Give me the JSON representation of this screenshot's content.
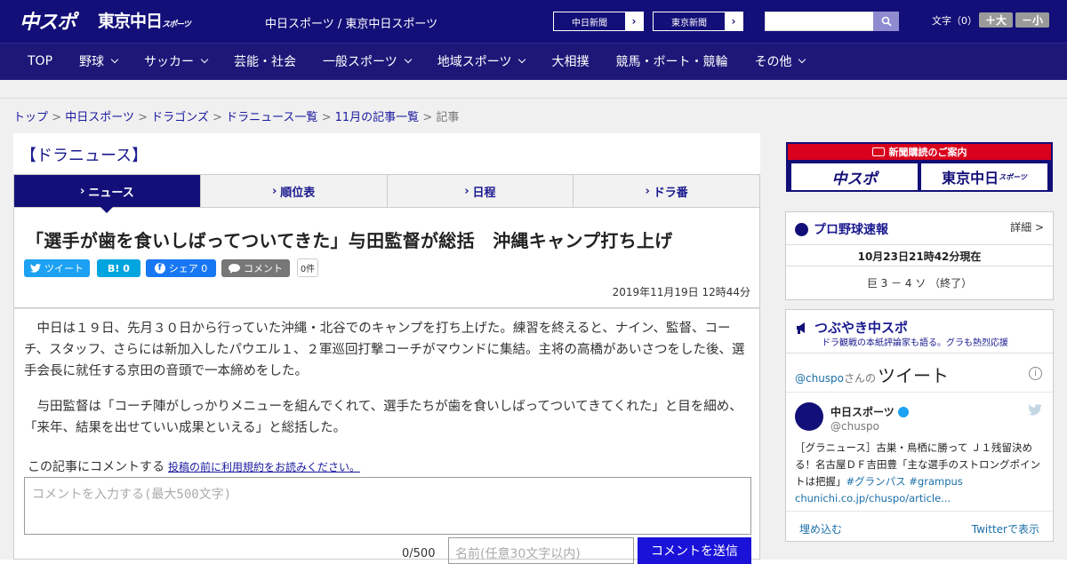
{
  "header": {
    "logo_chuspo": "中スポ",
    "logo_tokyo": "東京中日",
    "logo_tokyo_sub": "スポーツ",
    "site_name": "中日スポーツ / 東京中日スポーツ",
    "btn_chunichi": "中日新聞",
    "btn_tokyo": "東京新聞",
    "arrow": "›",
    "font_label": "文字（0）",
    "font_plus": "＋大",
    "font_minus": "－小"
  },
  "nav": {
    "items": [
      "TOP",
      "野球",
      "サッカー",
      "芸能・社会",
      "一般スポーツ",
      "地域スポーツ",
      "大相撲",
      "競馬・ボート・競輪",
      "その他"
    ]
  },
  "breadcrumb": {
    "items": [
      "トップ",
      "中日スポーツ",
      "ドラゴンズ",
      "ドラニュース一覧",
      "11月の記事一覧"
    ],
    "sep": ">",
    "current": "記事"
  },
  "section": {
    "title": "【ドラニュース】"
  },
  "tabs": [
    "ニュース",
    "順位表",
    "日程",
    "ドラ番"
  ],
  "tab_arrow": "›",
  "article": {
    "headline": "「選手が歯を食いしばってついてきた」与田監督が総括　沖縄キャンプ打ち上げ",
    "date": "2019年11月19日 12時44分",
    "p1": "中日は１９日、先月３０日から行っていた沖縄・北谷でのキャンプを打ち上げた。練習を終えると、ナイン、監督、コーチ、スタッフ、さらには新加入したパウエル１、２軍巡回打撃コーチがマウンドに集結。主将の高橋があいさつをした後、選手会長に就任する京田の音頭で一本締めをした。",
    "p2": "与田監督は「コーチ陣がしっかりメニューを組んでくれて、選手たちが歯を食いしばってついてきてくれた」と目を細め、「来年、結果を出せていい成果といえる」と総括した。"
  },
  "share": {
    "tweet": "ツイート",
    "hatena": "B! 0",
    "fb": "シェア 0",
    "comment": "コメント",
    "count": "0件"
  },
  "comment": {
    "label": "この記事にコメントする",
    "rules": "投稿の前に利用規約をお読みください。",
    "placeholder": "コメントを入力する(最大500文字)",
    "counter": "0/500",
    "name_placeholder": "名前(任意30文字以内)",
    "send": "コメントを送信"
  },
  "sidebar": {
    "ad_title": "新聞購読のご案内",
    "ad_left": "中スポ",
    "ad_right": "東京中日",
    "ad_right_sub": "スポーツ",
    "score_title": "プロ野球速報",
    "score_detail": "詳細 >",
    "score_time": "10月23日21時42分現在",
    "score_line": "巨 3 － 4 ソ （終了）",
    "tw_title": "つぶやき中スポ",
    "tw_sub": "ドラ観戦の本紙評論家も語る。グラも熱烈応援",
    "tw_handle": "@chuspo",
    "tw_handle_suffix": "さんの",
    "tw_head": "ツイート",
    "tw_name": "中日スポーツ",
    "tw_user": "@chuspo",
    "tw_text": "［グラニュース］古巣・鳥栖に勝って Ｊ１残留決める！名古屋ＤＦ吉田豊「主な選手のストロングポイントは把握」",
    "tw_tags": "#グランパス #grampus",
    "tw_link": "chunichi.co.jp/chuspo/article...",
    "tw_embed": "埋め込む",
    "tw_view": "Twitterで表示"
  },
  "colors": {
    "brand": "#130f78",
    "nav": "#1d1878",
    "send": "#1a12d9",
    "red": "#d8001c",
    "twitter": "#1da1f2",
    "facebook": "#1877f2",
    "hatena": "#00a4de"
  }
}
